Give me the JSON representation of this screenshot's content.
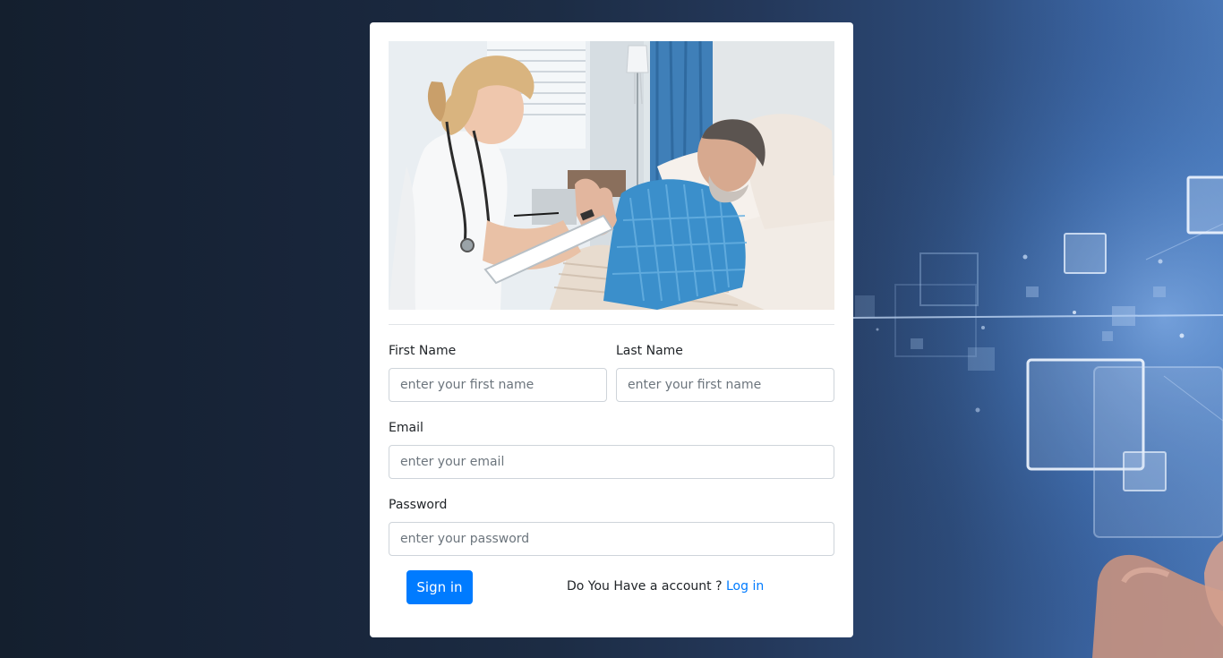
{
  "form": {
    "first_name_label": "First Name",
    "first_name_placeholder": "enter your first name",
    "last_name_label": "Last Name",
    "last_name_placeholder": "enter your first name",
    "email_label": "Email",
    "email_placeholder": "enter your email",
    "password_label": "Password",
    "password_placeholder": "enter your password",
    "signin_label": "Sign in",
    "account_prompt": "Do You Have a account ?",
    "login_link": "Log in"
  },
  "colors": {
    "primary": "#007bff",
    "card_background": "#ffffff",
    "page_background": "#18253a"
  }
}
